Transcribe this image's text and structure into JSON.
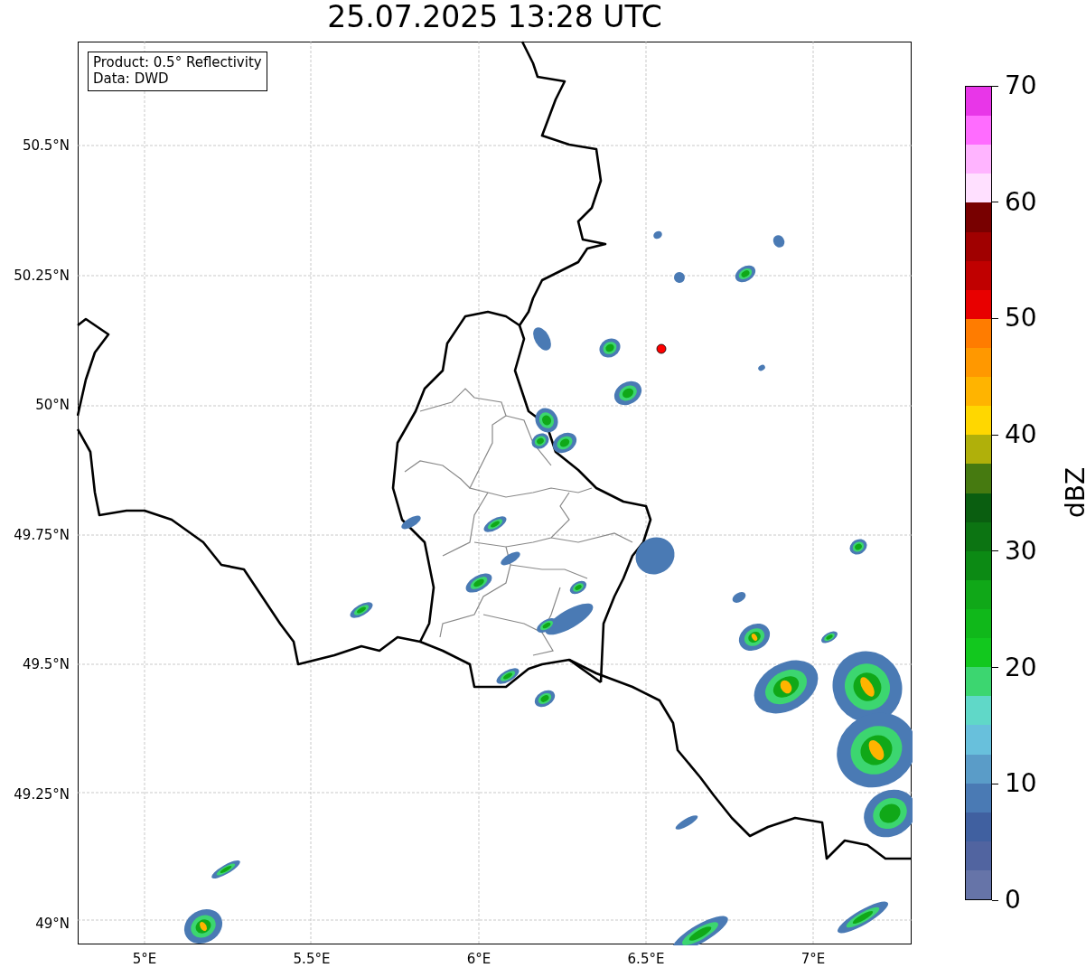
{
  "title": "25.07.2025 13:28 UTC",
  "info_box": {
    "lines": [
      "Product: 0.5° Reflectivity",
      "Data: DWD"
    ]
  },
  "map": {
    "lat_labels": [
      "50.5°N",
      "50.25°N",
      "50°N",
      "49.75°N",
      "49.5°N",
      "49.25°N",
      "49°N"
    ],
    "lon_labels": [
      "5°E",
      "5.5°E",
      "6°E",
      "6.5°E",
      "7°E"
    ]
  },
  "colorbar": {
    "label": "dBZ",
    "ticks": [
      "70",
      "60",
      "50",
      "40",
      "30",
      "20",
      "10",
      "0"
    ],
    "bins": [
      {
        "color": "#e836e8"
      },
      {
        "color": "#ff6cff"
      },
      {
        "color": "#ffb4ff"
      },
      {
        "color": "#ffe0ff"
      },
      {
        "color": "#780000"
      },
      {
        "color": "#a00000"
      },
      {
        "color": "#c00000"
      },
      {
        "color": "#e80000"
      },
      {
        "color": "#ff7c00"
      },
      {
        "color": "#ff9800"
      },
      {
        "color": "#ffb400"
      },
      {
        "color": "#ffd700"
      },
      {
        "color": "#b0b00a"
      },
      {
        "color": "#467a10"
      },
      {
        "color": "#0a5e10"
      },
      {
        "color": "#0c7412"
      },
      {
        "color": "#0c8a14"
      },
      {
        "color": "#10a818"
      },
      {
        "color": "#10b81a"
      },
      {
        "color": "#12c81e"
      },
      {
        "color": "#3cd670"
      },
      {
        "color": "#60d8c8"
      },
      {
        "color": "#68c0dc"
      },
      {
        "color": "#5a9cc8"
      },
      {
        "color": "#4a7ab4"
      },
      {
        "color": "#4060a0"
      },
      {
        "color": "#5164a0"
      },
      {
        "color": "#6674a8"
      }
    ]
  }
}
